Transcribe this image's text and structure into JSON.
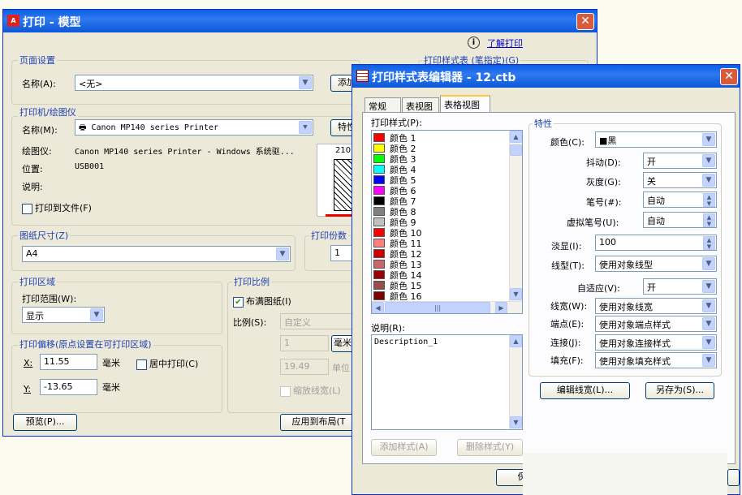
{
  "plot": {
    "title": "打印 - 模型",
    "help_link": "了解打印",
    "page_setup": {
      "group": "页面设置",
      "name_label": "名称(A):",
      "name_value": "<无>",
      "add_button": "添加"
    },
    "plotter": {
      "group": "打印机/绘图仪",
      "name_label": "名称(M):",
      "name_value": "Canon MP140 series Printer",
      "properties_button": "特性",
      "plotter_label": "绘图仪:",
      "plotter_value": "Canon MP140 series Printer - Windows 系统驱...",
      "where_label": "位置:",
      "where_value": "USB001",
      "desc_label": "说明:",
      "plot_to_file": "打印到文件(F)",
      "preview_dim": "210"
    },
    "paper_size": {
      "group": "图纸尺寸(Z)",
      "value": "A4"
    },
    "copies": {
      "group": "打印份数",
      "value": "1"
    },
    "plot_area": {
      "group": "打印区域",
      "range_label": "打印范围(W):",
      "range_value": "显示"
    },
    "scale": {
      "group": "打印比例",
      "fit_paper": "布满图纸(I)",
      "scale_label": "比例(S):",
      "scale_value": "自定义",
      "value1": "1",
      "unit1": "毫米",
      "value2": "19.49",
      "unit2": "单位",
      "scale_lineweights": "缩放线宽(L)"
    },
    "offset": {
      "group": "打印偏移(原点设置在可打印区域)",
      "x_label": "X:",
      "x_value": "11.55",
      "x_unit": "毫米",
      "center": "居中打印(C)",
      "y_label": "Y:",
      "y_value": "-13.65",
      "y_unit": "毫米"
    },
    "preview_button": "预览(P)...",
    "apply_button": "应用到布局(T",
    "style_table_label": "打印样式表 (笔指定)(G)"
  },
  "editor": {
    "title": "打印样式表编辑器 - 12.ctb",
    "tabs": [
      "常规",
      "表视图",
      "表格视图"
    ],
    "styles_label": "打印样式(P):",
    "styles": [
      {
        "label": "颜色 1",
        "color": "#ff0000"
      },
      {
        "label": "颜色 2",
        "color": "#ffff00"
      },
      {
        "label": "颜色 3",
        "color": "#00ff00"
      },
      {
        "label": "颜色 4",
        "color": "#00ffff"
      },
      {
        "label": "颜色 5",
        "color": "#0000ff"
      },
      {
        "label": "颜色 6",
        "color": "#ff00ff"
      },
      {
        "label": "颜色 7",
        "color": "#000000"
      },
      {
        "label": "颜色 8",
        "color": "#808080"
      },
      {
        "label": "颜色 9",
        "color": "#c0c0c0"
      },
      {
        "label": "颜色 10",
        "color": "#ff0000"
      },
      {
        "label": "颜色 11",
        "color": "#ff7f7f"
      },
      {
        "label": "颜色 12",
        "color": "#cc0000"
      },
      {
        "label": "颜色 13",
        "color": "#cc6666"
      },
      {
        "label": "颜色 14",
        "color": "#990000"
      },
      {
        "label": "颜色 15",
        "color": "#994c4c"
      },
      {
        "label": "颜色 16",
        "color": "#7f0000"
      }
    ],
    "desc_label": "说明(R):",
    "desc_value": "Description_1",
    "add_style": "添加样式(A)",
    "delete_style": "删除样式(Y)",
    "props": {
      "group": "特性",
      "color_label": "颜色(C):",
      "color_value": "■黑",
      "dither_label": "抖动(D):",
      "dither_value": "开",
      "grayscale_label": "灰度(G):",
      "grayscale_value": "关",
      "pen_label": "笔号(#):",
      "pen_value": "自动",
      "vpen_label": "虚拟笔号(U):",
      "vpen_value": "自动",
      "screening_label": "淡显(I):",
      "screening_value": "100",
      "linetype_label": "线型(T):",
      "linetype_value": "使用对象线型",
      "adaptive_label": "自适应(V):",
      "adaptive_value": "开",
      "lineweight_label": "线宽(W):",
      "lineweight_value": "使用对象线宽",
      "endstyle_label": "端点(E):",
      "endstyle_value": "使用对象端点样式",
      "joinstyle_label": "连接(J):",
      "joinstyle_value": "使用对象连接样式",
      "fill_label": "填充(F):",
      "fill_value": "使用对象填充样式"
    },
    "edit_lineweights": "编辑线宽(L)...",
    "save_as": "另存为(S)...",
    "bottom_button": "保"
  }
}
